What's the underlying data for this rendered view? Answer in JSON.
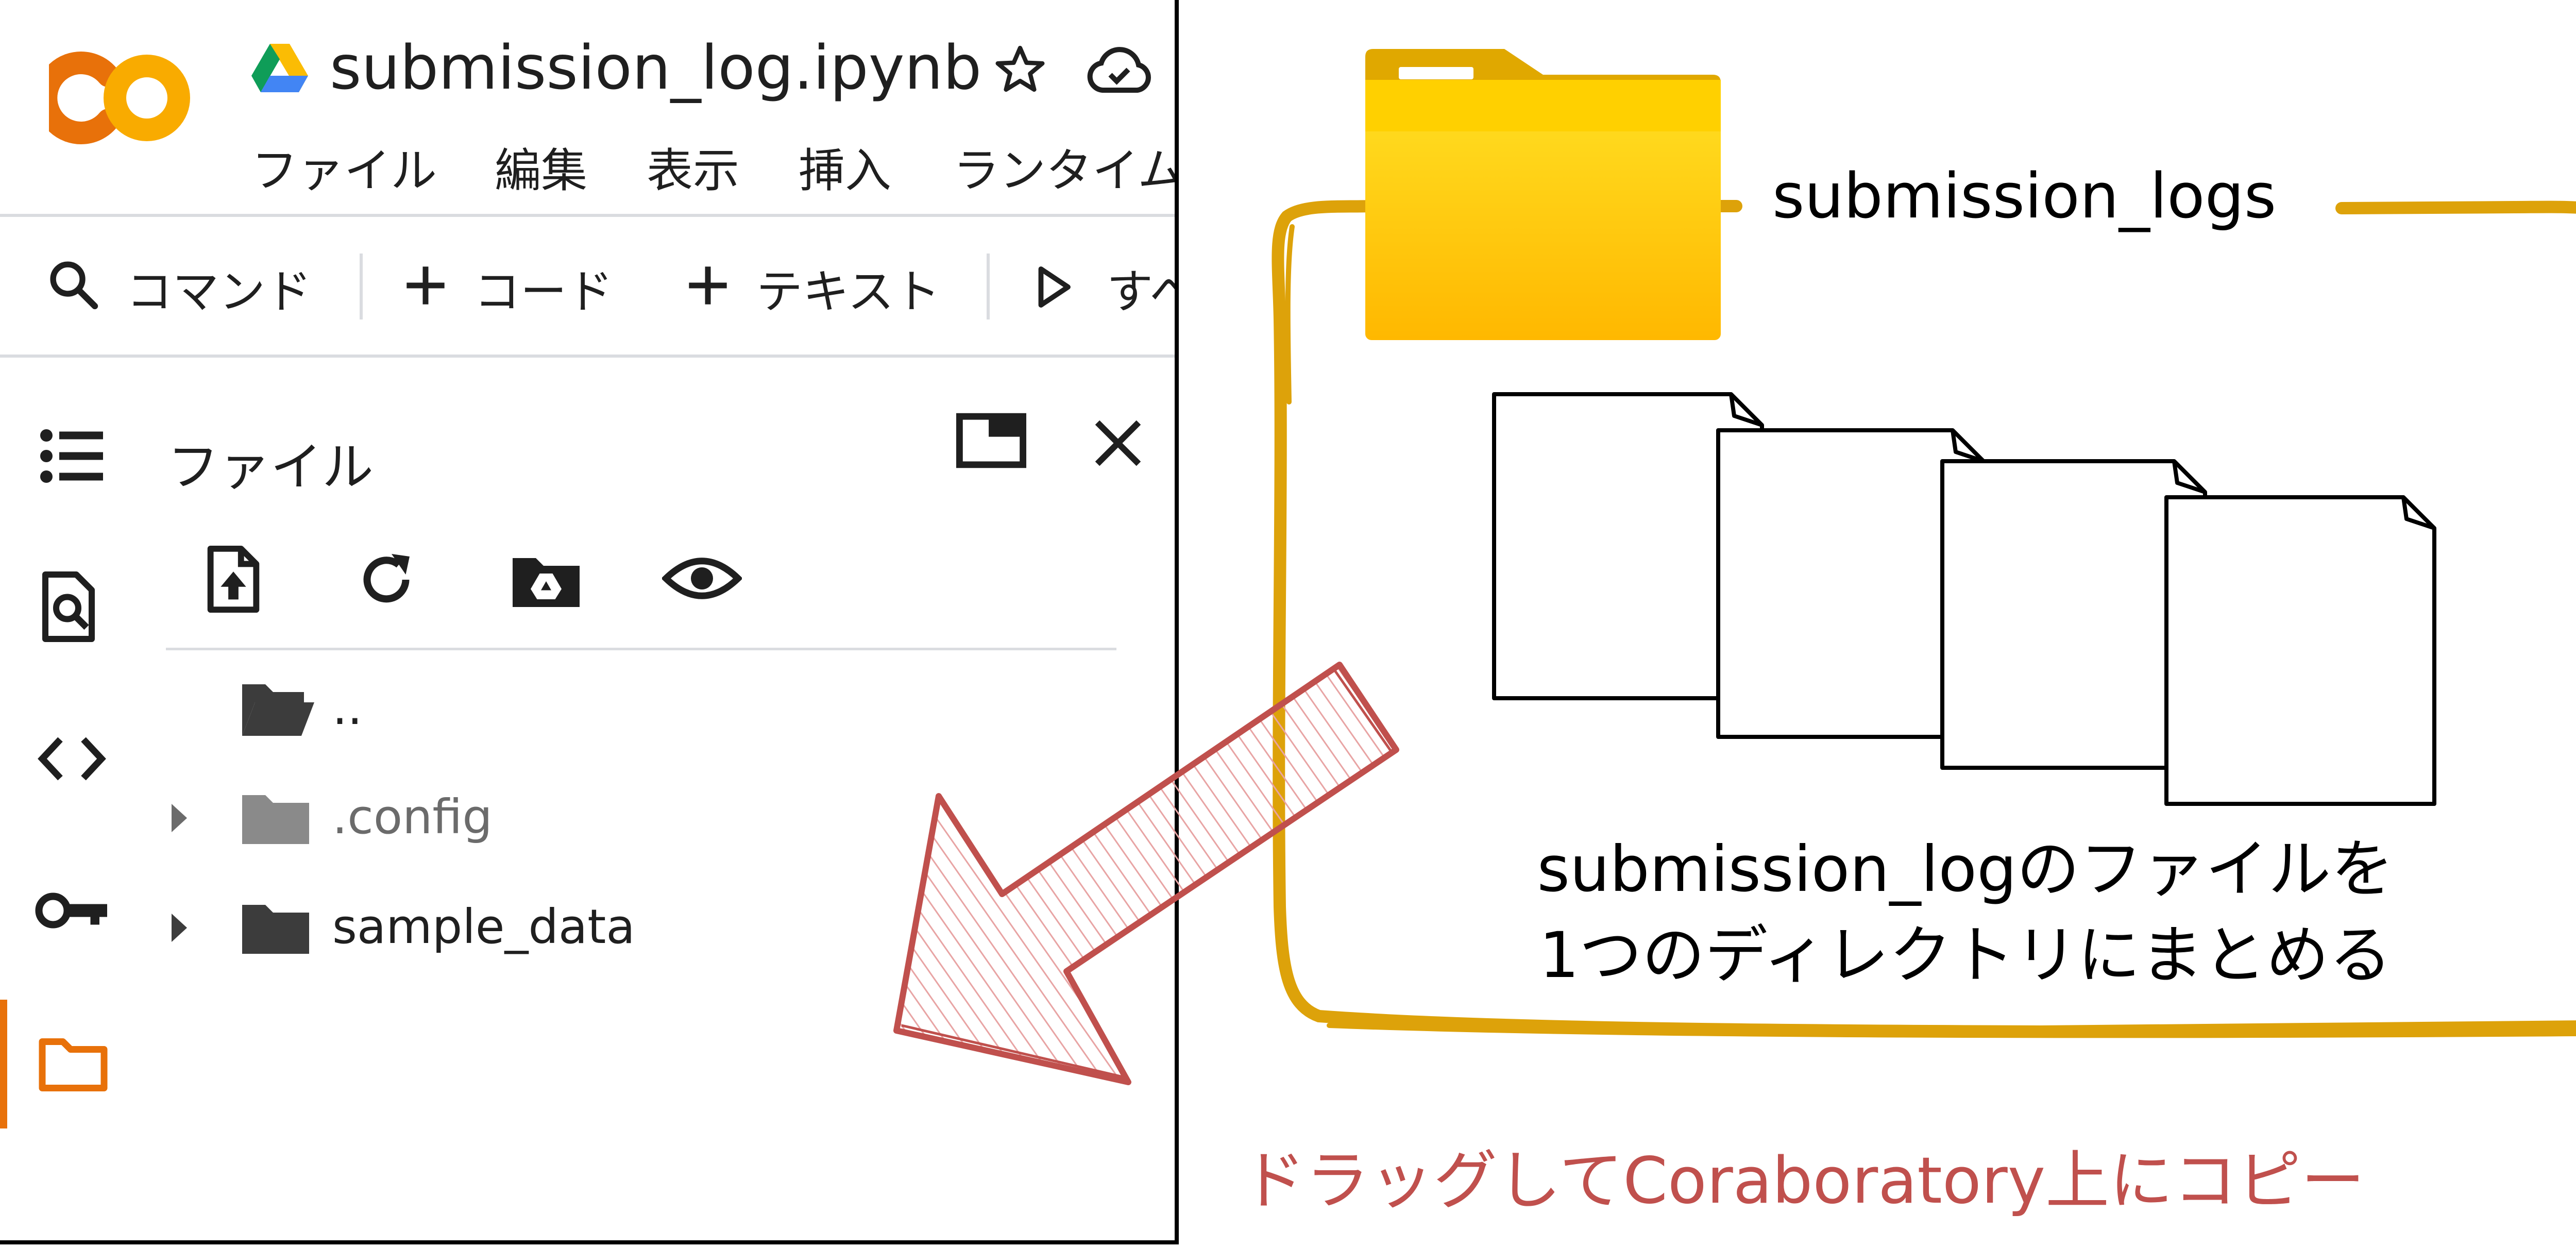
{
  "colab": {
    "logo_text": "CO",
    "notebook_title": "submission_log.ipynb",
    "menu": [
      "ファイル",
      "編集",
      "表示",
      "挿入",
      "ランタイム"
    ],
    "toolbar": {
      "command_label": "コマンド",
      "code_label": "コード",
      "text_label": "テキスト",
      "run_all_label": "すべ"
    },
    "sidebar_panel": {
      "title": "ファイル",
      "tree": [
        {
          "label": ".."
        },
        {
          "label": ".config"
        },
        {
          "label": "sample_data"
        }
      ]
    },
    "colors": {
      "accent_orange": "#e8710a",
      "logo_orange": "#f9ab00"
    }
  },
  "illustration": {
    "folder_label": "submission_logs",
    "description_line1": "submission_logのファイルを",
    "description_line2": "1つのディレクトリにまとめる",
    "caption": "ドラッグしてCoraboratory上にコピー",
    "colors": {
      "frame": "#dda20a",
      "folder": "#ffcc00",
      "arrow": "#c0504d"
    }
  }
}
